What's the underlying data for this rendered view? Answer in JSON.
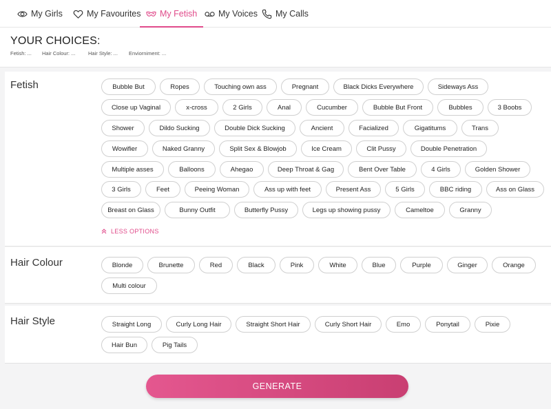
{
  "nav": {
    "tabs": [
      {
        "label": "My Girls",
        "icon": "eye-icon"
      },
      {
        "label": "My Favourites",
        "icon": "heart-icon"
      },
      {
        "label": "My Fetish",
        "icon": "mask-icon",
        "active": true
      },
      {
        "label": "My Voices",
        "icon": "voicemail-icon"
      },
      {
        "label": "My Calls",
        "icon": "phone-icon"
      }
    ]
  },
  "choices": {
    "title": "YOUR CHOICES:",
    "summary": [
      "Fetish: ...",
      "Hair Colour: ...",
      "Hair Style: ...",
      "Enviorniment: ..."
    ]
  },
  "fetish": {
    "title": "Fetish",
    "options": [
      "Bubble But",
      "Ropes",
      "Touching own ass",
      "Pregnant",
      "Black Dicks Everywhere",
      "Sideways Ass",
      "Close up Vaginal",
      "x-cross",
      "2 Girls",
      "Anal",
      "Cucumber",
      "Bubble But Front",
      "Bubbles",
      "3 Boobs",
      "Shower",
      "Dildo Sucking",
      "Double Dick Sucking",
      "Ancient",
      "Facialized",
      "Gigatitums",
      "Trans",
      "Wowifier",
      "Naked Granny",
      "Split Sex & Blowjob",
      "Ice Cream",
      "Clit Pussy",
      "Double Penetration",
      "Multiple asses",
      "Balloons",
      "Ahegao",
      "Deep Throat & Gag",
      "Bent Over Table",
      "4 Girls",
      "Golden Shower",
      "3 Girls",
      "Feet",
      "Peeing Woman",
      "Ass up with feet",
      "Present Ass",
      "5 Girls",
      "BBC riding",
      "Ass on Glass",
      "Breast on Glass",
      "Bunny Outfit",
      "Butterfly Pussy",
      "Legs up showing pussy",
      "Cameltoe",
      "Granny"
    ],
    "less_label": "LESS OPTIONS"
  },
  "hair_colour": {
    "title": "Hair Colour",
    "options": [
      "Blonde",
      "Brunette",
      "Red",
      "Black",
      "Pink",
      "White",
      "Blue",
      "Purple",
      "Ginger",
      "Orange",
      "Multi colour"
    ]
  },
  "hair_style": {
    "title": "Hair Style",
    "options": [
      "Straight Long",
      "Curly Long Hair",
      "Straight Short Hair",
      "Curly Short Hair",
      "Emo",
      "Ponytail",
      "Pixie",
      "Hair Bun",
      "Pig Tails"
    ]
  },
  "generate_label": "GENERATE",
  "colors": {
    "accent": "#e04a8a",
    "button_start": "#e4578f",
    "button_end": "#c93f72"
  }
}
